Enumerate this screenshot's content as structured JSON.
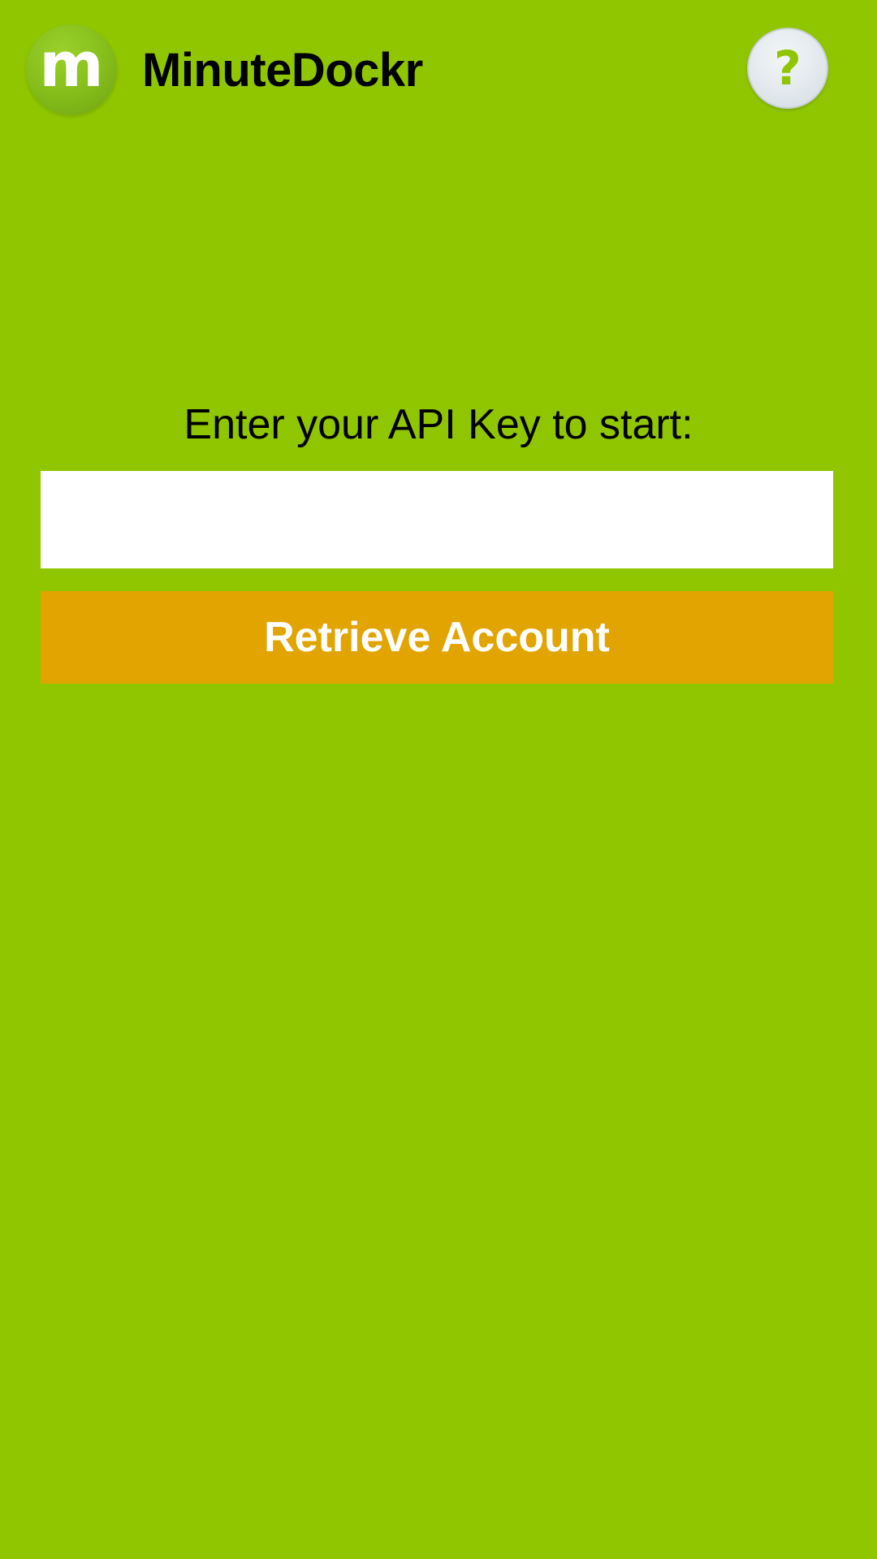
{
  "header": {
    "logo_letter": "m",
    "app_title": "MinuteDockr",
    "help_glyph": "?"
  },
  "icons": {
    "logo": "minutedockr-logo-icon",
    "help": "question-mark-icon"
  },
  "form": {
    "prompt": "Enter your API Key to start:",
    "api_key_value": "",
    "api_key_placeholder": "",
    "submit_label": "Retrieve Account"
  },
  "colors": {
    "background": "#8fc600",
    "button": "#e2a400",
    "button_text": "#ffffff",
    "input_background": "#ffffff",
    "help_button_background": "#dde5ea",
    "help_glyph": "#8fc600"
  }
}
